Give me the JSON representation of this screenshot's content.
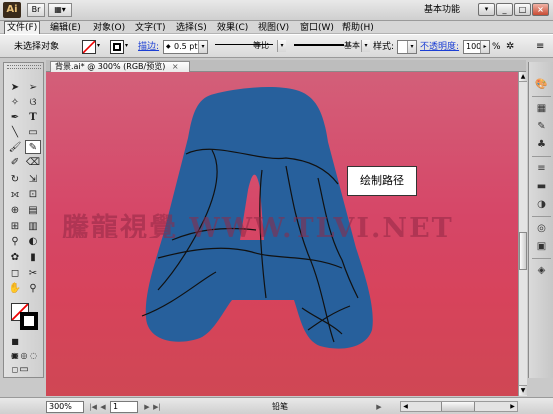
{
  "app": {
    "logo": "Ai",
    "workspace": "基本功能"
  },
  "menu": [
    "文件(F)",
    "编辑(E)",
    "对象(O)",
    "文字(T)",
    "选择(S)",
    "效果(C)",
    "视图(V)",
    "窗口(W)",
    "帮助(H)"
  ],
  "control_bar": {
    "selection": "未选择对象",
    "stroke_label": "描边:",
    "stroke_weight": "0.5 pt",
    "stroke_profile": "等比",
    "brush": "基本",
    "style_label": "样式:",
    "opacity_label": "不透明度:",
    "opacity_value": "100",
    "opacity_unit": "%"
  },
  "document": {
    "tab_title": "背景.ai* @ 300% (RGB/预览)"
  },
  "canvas": {
    "tooltip": "绘制路径",
    "watermark": "騰龍視覺 WWW.TLVI.NET",
    "background_color": "#d64667",
    "letter_color": "#27609c"
  },
  "status_bar": {
    "zoom": "300%",
    "page": "1",
    "tool": "铅笔"
  },
  "tools": [
    "selection-tool",
    "direct-selection-tool",
    "magic-wand-tool",
    "lasso-tool",
    "pen-tool",
    "type-tool",
    "line-segment-tool",
    "rectangle-tool",
    "paintbrush-tool",
    "pencil-tool",
    "blob-brush-tool",
    "eraser-tool",
    "rotate-tool",
    "scale-tool",
    "width-tool",
    "free-transform-tool",
    "shape-builder-tool",
    "perspective-grid-tool",
    "mesh-tool",
    "gradient-tool",
    "eyedropper-tool",
    "blend-tool",
    "symbol-sprayer-tool",
    "column-graph-tool",
    "artboard-tool",
    "slice-tool",
    "hand-tool",
    "zoom-tool"
  ]
}
